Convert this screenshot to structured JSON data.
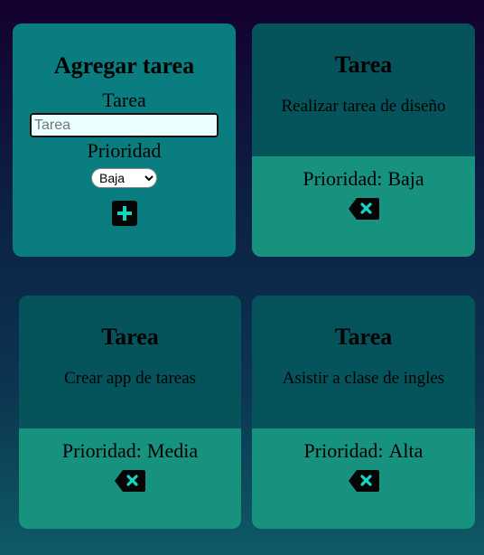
{
  "add_form": {
    "title": "Agregar tarea",
    "task_label": "Tarea",
    "task_placeholder": "Tarea",
    "priority_label": "Prioridad",
    "priority_selected": "Baja",
    "add_icon": "plus-icon"
  },
  "priority_prefix": "Prioridad:",
  "delete_icon": "backspace-delete-icon",
  "tasks": [
    {
      "title": "Tarea",
      "description": "Realizar tarea de diseño",
      "priority": "Baja"
    },
    {
      "title": "Tarea",
      "description": "Crear app de tareas",
      "priority": "Media"
    },
    {
      "title": "Tarea",
      "description": "Asistir a clase de ingles",
      "priority": "Alta"
    }
  ],
  "colors": {
    "form_card": "#0a7d80",
    "task_header": "#06545b",
    "task_footer": "#17927f",
    "icon_accent": "#12d6c2"
  }
}
